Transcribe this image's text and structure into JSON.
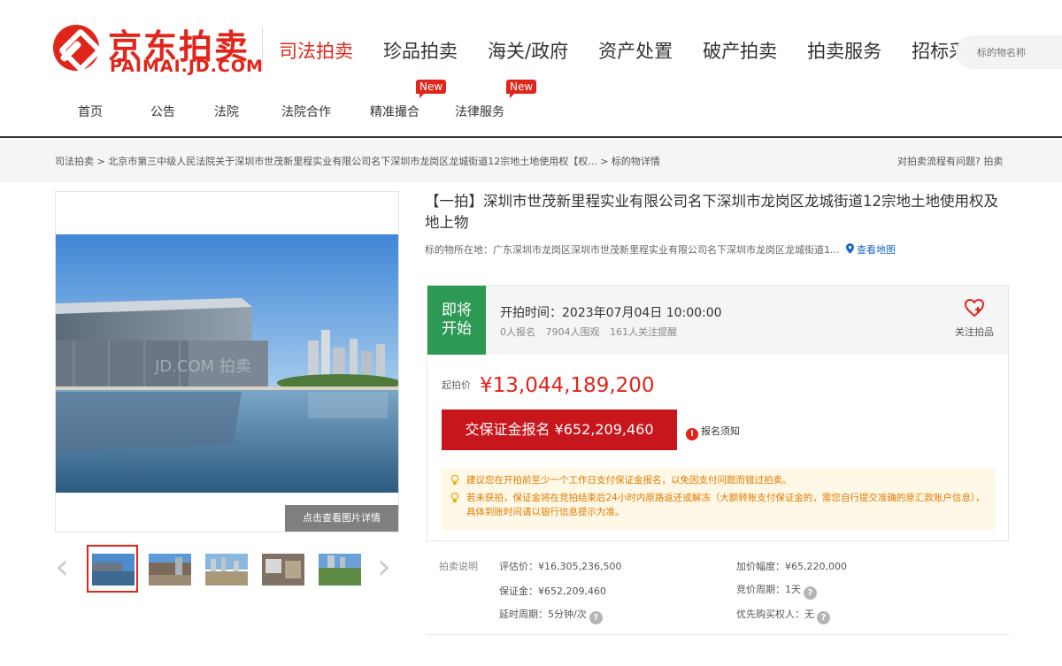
{
  "logo": {
    "cn": "京东拍卖",
    "en": "PAIMAI.JD.COM"
  },
  "nav": [
    {
      "label": "司法拍卖",
      "active": true
    },
    {
      "label": "珍品拍卖"
    },
    {
      "label": "海关/政府"
    },
    {
      "label": "资产处置"
    },
    {
      "label": "破产拍卖"
    },
    {
      "label": "拍卖服务"
    },
    {
      "label": "招标采购"
    }
  ],
  "search": {
    "placeholder": "标的物名称"
  },
  "subnav": [
    {
      "label": "首页"
    },
    {
      "label": "公告"
    },
    {
      "label": "法院"
    },
    {
      "label": "法院合作"
    },
    {
      "label": "精准撮合",
      "badge": "New"
    },
    {
      "label": "法律服务",
      "badge": "New"
    }
  ],
  "breadcrumb": {
    "path": "司法拍卖 > 北京市第三中级人民法院关于深圳市世茂新里程实业有限公司名下深圳市龙岗区龙城街道12宗地土地使用权【权... > 标的物详情",
    "help": "对拍卖流程有问题? 拍卖"
  },
  "gallery": {
    "watermark": "JD.COM 拍卖",
    "detail_button": "点击查看图片详情",
    "prev": "‹",
    "next": "›"
  },
  "item": {
    "title": "【一拍】深圳市世茂新里程实业有限公司名下深圳市龙岗区龙城街道12宗地土地使用权及地上物",
    "location_label": "标的物所在地：",
    "location": "广东深圳市龙岗区深圳市世茂新里程实业有限公司名下深圳市龙岗区龙城街道1...",
    "map_link": "查看地图"
  },
  "status": {
    "tag": "即将开始",
    "start_time": "开拍时间：2023年07月04日 10:00:00",
    "stats": [
      "0人报名",
      "7904人围观",
      "161人关注提醒"
    ],
    "follow_label": "关注拍品"
  },
  "price": {
    "label": "起拍价",
    "value": "¥13,044,189,200"
  },
  "deposit": {
    "button": "交保证金报名 ¥652,209,460",
    "notice": "报名须知"
  },
  "tips": [
    "建议您在开拍前至少一个工作日支付保证金报名，以免因支付问题而错过拍卖。",
    "若未获拍，保证金将在竞拍结束后24小时内原路返还或解冻（大额转账支付保证金的，需您自行提交准确的原汇款账户信息），具体到账时间请以银行信息提示为准。"
  ],
  "auction": {
    "label": "拍卖说明",
    "appraisal": "评估价：¥16,305,236,500",
    "increment": "加价幅度：¥65,220,000",
    "deposit": "保证金：¥652,209,460",
    "cycle": "竞价周期：1天",
    "delay": "延时周期：5分钟/次",
    "priority": "优先购买权人：无"
  },
  "colors": {
    "brand": "#e1251b",
    "status_green": "#2c9a55",
    "deposit_red": "#c8161d",
    "tip_orange": "#e07b00",
    "link_blue": "#1a67c9"
  }
}
